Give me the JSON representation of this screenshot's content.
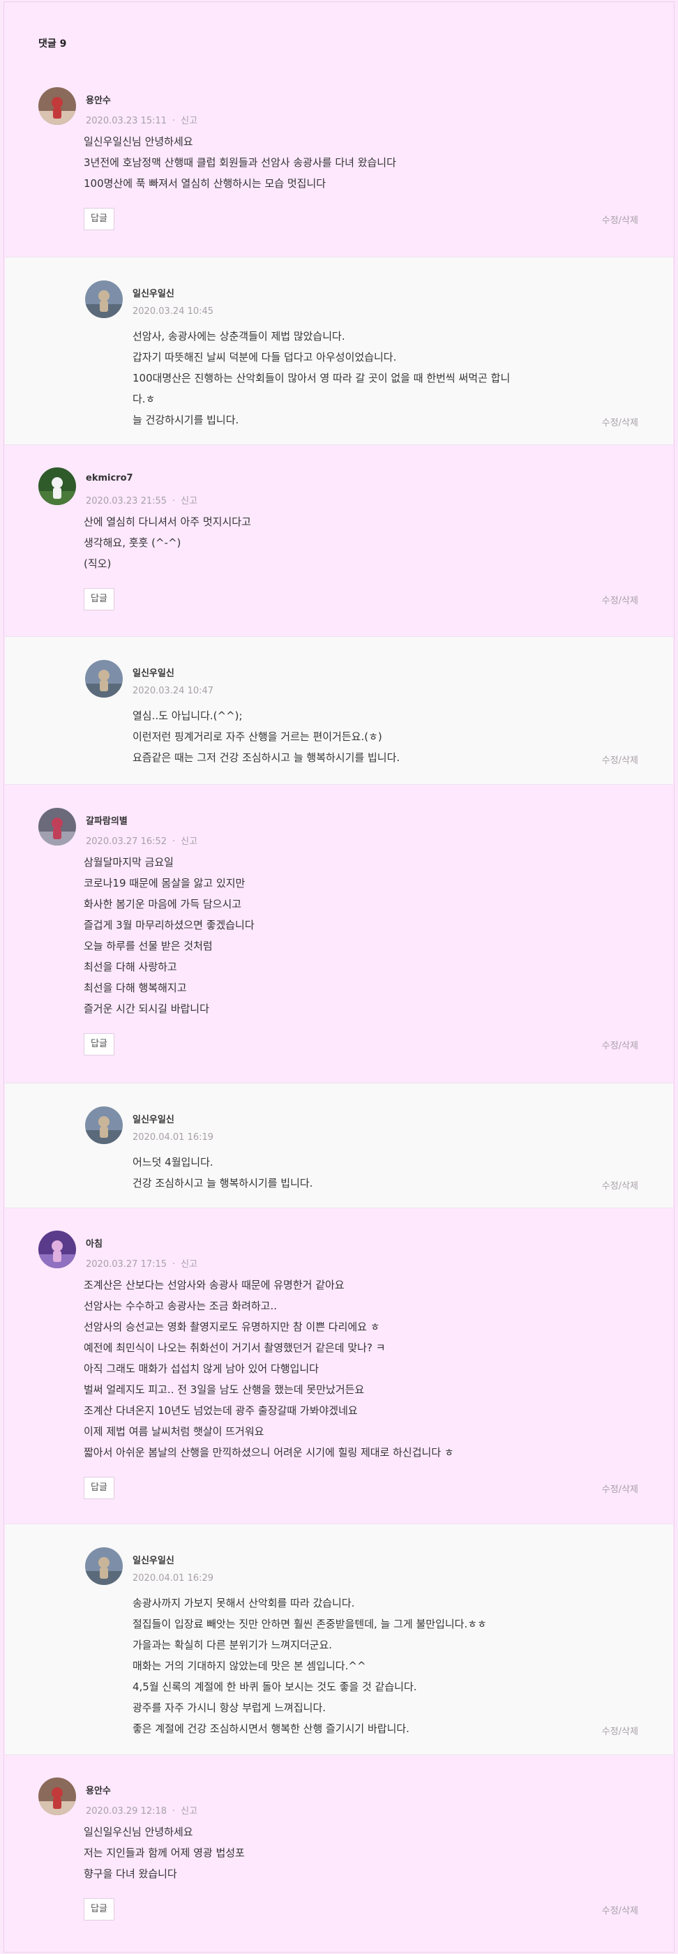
{
  "comments_header": {
    "label": "댓글",
    "count": "9"
  },
  "actions": {
    "reply_label": "답글",
    "edit_delete_label": "수정/삭제",
    "report_label": "신고",
    "separator": "·"
  },
  "comments": [
    {
      "author": "용안수",
      "date": "2020.03.23 15:11",
      "avatar": "avatar-photo",
      "is_reply": false,
      "lines": [
        "일신우일신님 안녕하세요",
        "3년전에 호남정맥 산행때 클럽 회원들과 선암사 송광사를 다녀 왔습니다",
        "100명산에 푹 빠져서 열심히 산행하시는 모습 멋집니다"
      ]
    },
    {
      "author": "일신우일신",
      "date": "2020.03.24 10:45",
      "avatar": "avatar-photo",
      "is_reply": true,
      "lines": [
        "선암사, 송광사에는 상춘객들이 제법 많았습니다.",
        "갑자기 따뜻해진 날씨 덕분에 다들 덥다고 아우성이었습니다.",
        "100대명산은 진행하는 산악회들이 많아서 영 따라 갈 곳이 없을 때 한번씩 써먹곤 합니",
        "다.ㅎ",
        "늘 건강하시기를 빕니다."
      ]
    },
    {
      "author": "ekmicro7",
      "date": "2020.03.23 21:55",
      "avatar": "avatar-photo",
      "is_reply": false,
      "lines": [
        "산에 열심히 다니셔서 아주 멋지시다고",
        "생각해요, 훗훗 (^-^)",
        "(직오)"
      ]
    },
    {
      "author": "일신우일신",
      "date": "2020.03.24 10:47",
      "avatar": "avatar-photo",
      "is_reply": true,
      "lines": [
        "열심..도 아닙니다.(^^);",
        "이런저런 핑계거리로 자주 산행을 거르는 편이거든요.(ㅎ)",
        "요즘같은 때는 그저 건강 조심하시고 늘 행복하시기를 빕니다."
      ]
    },
    {
      "author": "갈파람의별",
      "date": "2020.03.27 16:52",
      "avatar": "avatar-photo",
      "is_reply": false,
      "lines": [
        "삼월달마지막 금요일",
        "코로나19 때문에 몸살을 앓고 있지만",
        "화사한 봄기운 마음에 가득 담으시고",
        "즐겁게 3월 마무리하셨으면 좋겠습니다",
        "오늘 하루를 선물 받은 것처럼",
        "최선을 다해 사랑하고",
        "최선을 다해 행복해지고",
        "즐거운 시간 되시길 바랍니다"
      ]
    },
    {
      "author": "일신우일신",
      "date": "2020.04.01 16:19",
      "avatar": "avatar-photo",
      "is_reply": true,
      "lines": [
        "어느덧 4월입니다.",
        "건강 조심하시고 늘 행복하시기를 빕니다."
      ]
    },
    {
      "author": "아침",
      "date": "2020.03.27 17:15",
      "avatar": "avatar-photo",
      "is_reply": false,
      "lines": [
        "조계산은 산보다는 선암사와 송광사 때문에 유명한거 같아요",
        "선암사는 수수하고 송광사는 조금 화려하고..",
        "선암사의 승선교는 영화 촬영지로도 유명하지만 참 이쁜 다리에요 ㅎ",
        "예전에 최민식이 나오는 취화선이 거기서 촬영했던거 같은데 맞나? ㅋ",
        "아직 그래도 매화가 섭섭치 않게 남아 있어 다행입니다",
        "벌써 얼레지도 피고.. 전 3일을 남도 산행을 했는데 못만났거든요",
        "조계산 다녀온지 10년도 넘었는데 광주 출장갈때 가봐야겠네요",
        "이제 제법 여름 날씨처럼 햇살이 뜨거워요",
        "짧아서 아쉬운 봄날의 산행을 만끽하셨으니 어려운 시기에 힐링 제대로 하신겁니다 ㅎ"
      ]
    },
    {
      "author": "일신우일신",
      "date": "2020.04.01 16:29",
      "avatar": "avatar-photo",
      "is_reply": true,
      "lines": [
        "송광사까지 가보지 못해서 산악회를 따라 갔습니다.",
        "절집들이 입장료 빼앗는 짓만 안하면 훨씬 존중받을텐데, 늘 그게 불만입니다.ㅎㅎ",
        "가을과는 확실히 다른 분위기가 느껴지더군요.",
        "매화는 거의 기대하지 않았는데 맛은 본 셈입니다.^^",
        "4,5월 신록의 계절에 한 바퀴 돌아 보시는 것도 좋을 것 같습니다.",
        "광주를 자주 가시니 항상 부럽게 느껴집니다.",
        "좋은 계절에 건강 조심하시면서 행복한 산행 즐기시기 바랍니다."
      ]
    },
    {
      "author": "용안수",
      "date": "2020.03.29 12:18",
      "avatar": "avatar-photo",
      "is_reply": false,
      "lines": [
        "일신일우신님 안녕하세요",
        "저는 지인들과 함께 어제 영광 법성포",
        "향구을 다녀 왔습니다"
      ]
    }
  ]
}
